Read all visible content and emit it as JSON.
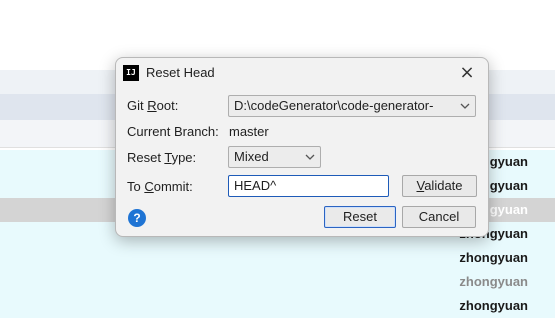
{
  "background": {
    "authors": [
      "zhongyuan",
      "zhongyuan",
      "zhongyuan",
      "zhongyuan",
      "zhongyuan",
      "zhongyuan",
      "zhongyuan"
    ]
  },
  "dialog": {
    "title": "Reset Head",
    "app_icon": "intellij-icon",
    "fields": {
      "git_root": {
        "label_pre": "Git ",
        "label_mnemonic": "R",
        "label_post": "oot:",
        "value": "D:\\codeGenerator\\code-generator-"
      },
      "current_branch": {
        "label": "Current Branch:",
        "value": "master"
      },
      "reset_type": {
        "label_pre": "Reset ",
        "label_mnemonic": "T",
        "label_post": "ype:",
        "value": "Mixed"
      },
      "to_commit": {
        "label_pre": "To ",
        "label_mnemonic": "C",
        "label_post": "ommit:",
        "value": "HEAD^"
      }
    },
    "buttons": {
      "validate_pre": "",
      "validate_mnemonic": "V",
      "validate_post": "alidate",
      "reset": "Reset",
      "cancel": "Cancel"
    },
    "help_icon_glyph": "?"
  },
  "colors": {
    "accent": "#1e5bb8",
    "help_blue": "#1f74d4"
  }
}
